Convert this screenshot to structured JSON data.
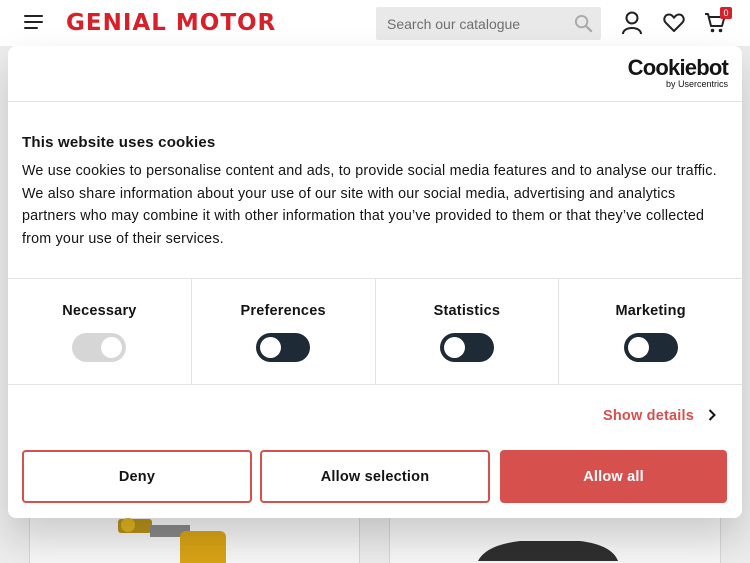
{
  "header": {
    "logo": {
      "part1": "GENIAL",
      "part2": "MOTOR"
    },
    "search": {
      "placeholder": "Search our catalogue"
    },
    "cart": {
      "count": "0"
    },
    "icons": [
      "menu-icon",
      "search-icon",
      "user-icon",
      "heart-icon",
      "cart-icon"
    ]
  },
  "dialog": {
    "brand": {
      "name": "Cookiebot",
      "sub": "by Usercentrics"
    },
    "title": "This website uses cookies",
    "body": "We use cookies to personalise content and ads, to provide social media features and to analyse our traffic. We also share information about your use of our site with our social media, advertising and analytics partners who may combine it with other information that you’ve provided to them or that they’ve collected from your use of their services.",
    "categories": [
      {
        "label": "Necessary",
        "enabled": true,
        "locked": true
      },
      {
        "label": "Preferences",
        "enabled": false
      },
      {
        "label": "Statistics",
        "enabled": false
      },
      {
        "label": "Marketing",
        "enabled": false
      }
    ],
    "show_details": "Show details",
    "buttons": {
      "deny": "Deny",
      "allow_selection": "Allow selection",
      "allow_all": "Allow all"
    }
  },
  "colors": {
    "accent": "#d6504d",
    "brand_red": "#d8202a",
    "toggle_off": "#1e2a36"
  }
}
